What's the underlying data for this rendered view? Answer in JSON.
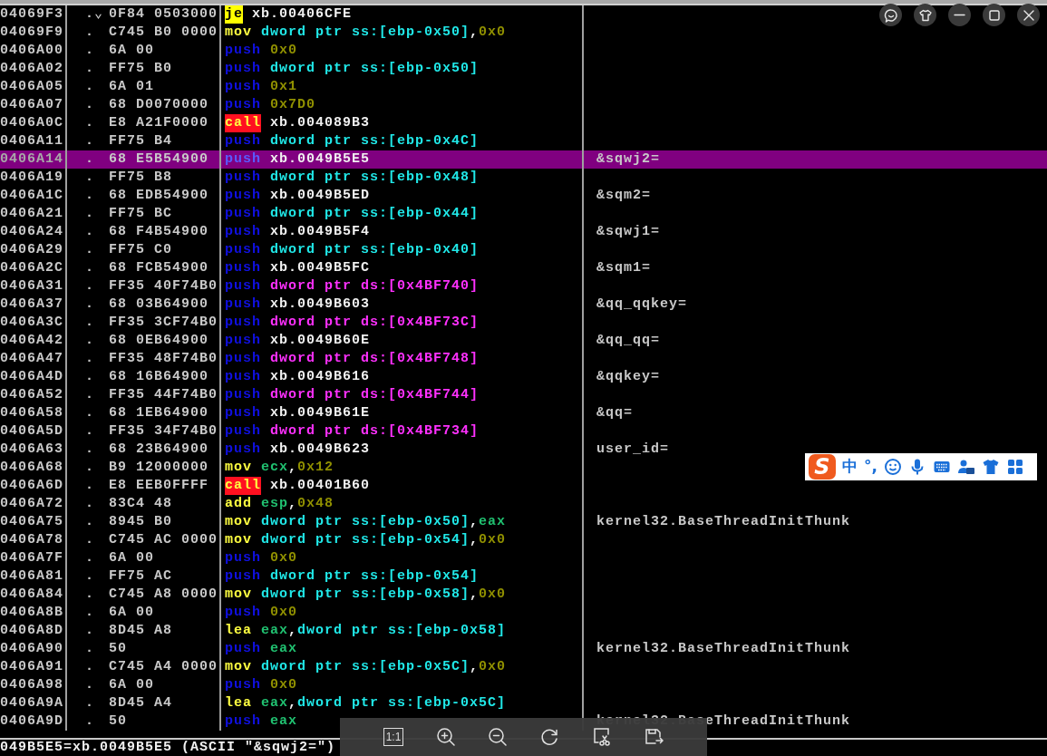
{
  "rows": [
    {
      "address": "04069F3",
      "marker": ".⌄",
      "hex": "0F84 0503000",
      "mnemonic": {
        "text": "je",
        "kind": "jump"
      },
      "operands": [
        {
          "text": "xb.00406CFE",
          "kind": "label"
        }
      ],
      "selected": false
    },
    {
      "address": "04069F9",
      "marker": ".",
      "hex": "C745 B0 0000",
      "mnemonic": {
        "text": "mov",
        "kind": "alu"
      },
      "operands": [
        {
          "text": "dword ptr ss:[ebp-0x50]",
          "kind": "stack"
        },
        {
          "text": ",",
          "kind": "sep"
        },
        {
          "text": "0x0",
          "kind": "const"
        }
      ],
      "selected": false
    },
    {
      "address": "0406A00",
      "marker": ".",
      "hex": "6A 00",
      "mnemonic": {
        "text": "push",
        "kind": "push"
      },
      "operands": [
        {
          "text": "0x0",
          "kind": "const"
        }
      ],
      "selected": false
    },
    {
      "address": "0406A02",
      "marker": ".",
      "hex": "FF75 B0",
      "mnemonic": {
        "text": "push",
        "kind": "push"
      },
      "operands": [
        {
          "text": "dword ptr ss:[ebp-0x50]",
          "kind": "stack"
        }
      ],
      "selected": false
    },
    {
      "address": "0406A05",
      "marker": ".",
      "hex": "6A 01",
      "mnemonic": {
        "text": "push",
        "kind": "push"
      },
      "operands": [
        {
          "text": "0x1",
          "kind": "const"
        }
      ],
      "selected": false
    },
    {
      "address": "0406A07",
      "marker": ".",
      "hex": "68 D0070000",
      "mnemonic": {
        "text": "push",
        "kind": "push"
      },
      "operands": [
        {
          "text": "0x7D0",
          "kind": "const"
        }
      ],
      "selected": false
    },
    {
      "address": "0406A0C",
      "marker": ".",
      "hex": "E8 A21F0000",
      "mnemonic": {
        "text": "call",
        "kind": "call"
      },
      "operands": [
        {
          "text": "xb.004089B3",
          "kind": "label"
        }
      ],
      "selected": false
    },
    {
      "address": "0406A11",
      "marker": ".",
      "hex": "FF75 B4",
      "mnemonic": {
        "text": "push",
        "kind": "push"
      },
      "operands": [
        {
          "text": "dword ptr ss:[ebp-0x4C]",
          "kind": "stack"
        }
      ],
      "selected": false
    },
    {
      "address": "0406A14",
      "marker": ".",
      "hex": "68 E5B54900",
      "mnemonic": {
        "text": "push",
        "kind": "push"
      },
      "operands": [
        {
          "text": "xb.0049B5E5",
          "kind": "label"
        }
      ],
      "comment": "&sqwj2=",
      "selected": true
    },
    {
      "address": "0406A19",
      "marker": ".",
      "hex": "FF75 B8",
      "mnemonic": {
        "text": "push",
        "kind": "push"
      },
      "operands": [
        {
          "text": "dword ptr ss:[ebp-0x48]",
          "kind": "stack"
        }
      ],
      "selected": false
    },
    {
      "address": "0406A1C",
      "marker": ".",
      "hex": "68 EDB54900",
      "mnemonic": {
        "text": "push",
        "kind": "push"
      },
      "operands": [
        {
          "text": "xb.0049B5ED",
          "kind": "label"
        }
      ],
      "comment": "&sqm2=",
      "selected": false
    },
    {
      "address": "0406A21",
      "marker": ".",
      "hex": "FF75 BC",
      "mnemonic": {
        "text": "push",
        "kind": "push"
      },
      "operands": [
        {
          "text": "dword ptr ss:[ebp-0x44]",
          "kind": "stack"
        }
      ],
      "selected": false
    },
    {
      "address": "0406A24",
      "marker": ".",
      "hex": "68 F4B54900",
      "mnemonic": {
        "text": "push",
        "kind": "push"
      },
      "operands": [
        {
          "text": "xb.0049B5F4",
          "kind": "label"
        }
      ],
      "comment": "&sqwj1=",
      "selected": false
    },
    {
      "address": "0406A29",
      "marker": ".",
      "hex": "FF75 C0",
      "mnemonic": {
        "text": "push",
        "kind": "push"
      },
      "operands": [
        {
          "text": "dword ptr ss:[ebp-0x40]",
          "kind": "stack"
        }
      ],
      "selected": false
    },
    {
      "address": "0406A2C",
      "marker": ".",
      "hex": "68 FCB54900",
      "mnemonic": {
        "text": "push",
        "kind": "push"
      },
      "operands": [
        {
          "text": "xb.0049B5FC",
          "kind": "label"
        }
      ],
      "comment": "&sqm1=",
      "selected": false
    },
    {
      "address": "0406A31",
      "marker": ".",
      "hex": "FF35 40F74B0",
      "mnemonic": {
        "text": "push",
        "kind": "push"
      },
      "operands": [
        {
          "text": "dword ptr ds:[0x4BF740]",
          "kind": "global"
        }
      ],
      "selected": false
    },
    {
      "address": "0406A37",
      "marker": ".",
      "hex": "68 03B64900",
      "mnemonic": {
        "text": "push",
        "kind": "push"
      },
      "operands": [
        {
          "text": "xb.0049B603",
          "kind": "label"
        }
      ],
      "comment": "&qq_qqkey=",
      "selected": false
    },
    {
      "address": "0406A3C",
      "marker": ".",
      "hex": "FF35 3CF74B0",
      "mnemonic": {
        "text": "push",
        "kind": "push"
      },
      "operands": [
        {
          "text": "dword ptr ds:[0x4BF73C]",
          "kind": "global"
        }
      ],
      "selected": false
    },
    {
      "address": "0406A42",
      "marker": ".",
      "hex": "68 0EB64900",
      "mnemonic": {
        "text": "push",
        "kind": "push"
      },
      "operands": [
        {
          "text": "xb.0049B60E",
          "kind": "label"
        }
      ],
      "comment": "&qq_qq=",
      "selected": false
    },
    {
      "address": "0406A47",
      "marker": ".",
      "hex": "FF35 48F74B0",
      "mnemonic": {
        "text": "push",
        "kind": "push"
      },
      "operands": [
        {
          "text": "dword ptr ds:[0x4BF748]",
          "kind": "global"
        }
      ],
      "selected": false
    },
    {
      "address": "0406A4D",
      "marker": ".",
      "hex": "68 16B64900",
      "mnemonic": {
        "text": "push",
        "kind": "push"
      },
      "operands": [
        {
          "text": "xb.0049B616",
          "kind": "label"
        }
      ],
      "comment": "&qqkey=",
      "selected": false
    },
    {
      "address": "0406A52",
      "marker": ".",
      "hex": "FF35 44F74B0",
      "mnemonic": {
        "text": "push",
        "kind": "push"
      },
      "operands": [
        {
          "text": "dword ptr ds:[0x4BF744]",
          "kind": "global"
        }
      ],
      "selected": false
    },
    {
      "address": "0406A58",
      "marker": ".",
      "hex": "68 1EB64900",
      "mnemonic": {
        "text": "push",
        "kind": "push"
      },
      "operands": [
        {
          "text": "xb.0049B61E",
          "kind": "label"
        }
      ],
      "comment": "&qq=",
      "selected": false
    },
    {
      "address": "0406A5D",
      "marker": ".",
      "hex": "FF35 34F74B0",
      "mnemonic": {
        "text": "push",
        "kind": "push"
      },
      "operands": [
        {
          "text": "dword ptr ds:[0x4BF734]",
          "kind": "global"
        }
      ],
      "selected": false
    },
    {
      "address": "0406A63",
      "marker": ".",
      "hex": "68 23B64900",
      "mnemonic": {
        "text": "push",
        "kind": "push"
      },
      "operands": [
        {
          "text": "xb.0049B623",
          "kind": "label"
        }
      ],
      "comment": "user_id=",
      "selected": false
    },
    {
      "address": "0406A68",
      "marker": ".",
      "hex": "B9 12000000",
      "mnemonic": {
        "text": "mov",
        "kind": "alu"
      },
      "operands": [
        {
          "text": "ecx",
          "kind": "reg"
        },
        {
          "text": ",",
          "kind": "sep"
        },
        {
          "text": "0x12",
          "kind": "const"
        }
      ],
      "selected": false
    },
    {
      "address": "0406A6D",
      "marker": ".",
      "hex": "E8 EEB0FFFF",
      "mnemonic": {
        "text": "call",
        "kind": "call"
      },
      "operands": [
        {
          "text": "xb.00401B60",
          "kind": "label"
        }
      ],
      "selected": false
    },
    {
      "address": "0406A72",
      "marker": ".",
      "hex": "83C4 48",
      "mnemonic": {
        "text": "add",
        "kind": "alu"
      },
      "operands": [
        {
          "text": "esp",
          "kind": "reg"
        },
        {
          "text": ",",
          "kind": "sep"
        },
        {
          "text": "0x48",
          "kind": "const"
        }
      ],
      "selected": false
    },
    {
      "address": "0406A75",
      "marker": ".",
      "hex": "8945 B0",
      "mnemonic": {
        "text": "mov",
        "kind": "alu"
      },
      "operands": [
        {
          "text": "dword ptr ss:[ebp-0x50]",
          "kind": "stack"
        },
        {
          "text": ",",
          "kind": "sep"
        },
        {
          "text": "eax",
          "kind": "reg"
        }
      ],
      "comment": "kernel32.BaseThreadInitThunk",
      "selected": false
    },
    {
      "address": "0406A78",
      "marker": ".",
      "hex": "C745 AC 0000",
      "mnemonic": {
        "text": "mov",
        "kind": "alu"
      },
      "operands": [
        {
          "text": "dword ptr ss:[ebp-0x54]",
          "kind": "stack"
        },
        {
          "text": ",",
          "kind": "sep"
        },
        {
          "text": "0x0",
          "kind": "const"
        }
      ],
      "selected": false
    },
    {
      "address": "0406A7F",
      "marker": ".",
      "hex": "6A 00",
      "mnemonic": {
        "text": "push",
        "kind": "push"
      },
      "operands": [
        {
          "text": "0x0",
          "kind": "const"
        }
      ],
      "selected": false
    },
    {
      "address": "0406A81",
      "marker": ".",
      "hex": "FF75 AC",
      "mnemonic": {
        "text": "push",
        "kind": "push"
      },
      "operands": [
        {
          "text": "dword ptr ss:[ebp-0x54]",
          "kind": "stack"
        }
      ],
      "selected": false
    },
    {
      "address": "0406A84",
      "marker": ".",
      "hex": "C745 A8 0000",
      "mnemonic": {
        "text": "mov",
        "kind": "alu"
      },
      "operands": [
        {
          "text": "dword ptr ss:[ebp-0x58]",
          "kind": "stack"
        },
        {
          "text": ",",
          "kind": "sep"
        },
        {
          "text": "0x0",
          "kind": "const"
        }
      ],
      "selected": false
    },
    {
      "address": "0406A8B",
      "marker": ".",
      "hex": "6A 00",
      "mnemonic": {
        "text": "push",
        "kind": "push"
      },
      "operands": [
        {
          "text": "0x0",
          "kind": "const"
        }
      ],
      "selected": false
    },
    {
      "address": "0406A8D",
      "marker": ".",
      "hex": "8D45 A8",
      "mnemonic": {
        "text": "lea",
        "kind": "alu"
      },
      "operands": [
        {
          "text": "eax",
          "kind": "reg"
        },
        {
          "text": ",",
          "kind": "sep"
        },
        {
          "text": "dword ptr ss:[ebp-0x58]",
          "kind": "stack"
        }
      ],
      "selected": false
    },
    {
      "address": "0406A90",
      "marker": ".",
      "hex": "50",
      "mnemonic": {
        "text": "push",
        "kind": "push"
      },
      "operands": [
        {
          "text": "eax",
          "kind": "reg"
        }
      ],
      "comment": "kernel32.BaseThreadInitThunk",
      "selected": false
    },
    {
      "address": "0406A91",
      "marker": ".",
      "hex": "C745 A4 0000",
      "mnemonic": {
        "text": "mov",
        "kind": "alu"
      },
      "operands": [
        {
          "text": "dword ptr ss:[ebp-0x5C]",
          "kind": "stack"
        },
        {
          "text": ",",
          "kind": "sep"
        },
        {
          "text": "0x0",
          "kind": "const"
        }
      ],
      "selected": false
    },
    {
      "address": "0406A98",
      "marker": ".",
      "hex": "6A 00",
      "mnemonic": {
        "text": "push",
        "kind": "push"
      },
      "operands": [
        {
          "text": "0x0",
          "kind": "const"
        }
      ],
      "selected": false
    },
    {
      "address": "0406A9A",
      "marker": ".",
      "hex": "8D45 A4",
      "mnemonic": {
        "text": "lea",
        "kind": "alu"
      },
      "operands": [
        {
          "text": "eax",
          "kind": "reg"
        },
        {
          "text": ",",
          "kind": "sep"
        },
        {
          "text": "dword ptr ss:[ebp-0x5C]",
          "kind": "stack"
        }
      ],
      "selected": false
    },
    {
      "address": "0406A9D",
      "marker": ".",
      "hex": "50",
      "mnemonic": {
        "text": "push",
        "kind": "push"
      },
      "operands": [
        {
          "text": "eax",
          "kind": "reg"
        }
      ],
      "comment": "kernel32.BaseThreadInitThunk",
      "selected": false
    }
  ],
  "status_bar": "049B5E5=xb.0049B5E5 (ASCII \"&sqwj2=\")",
  "ime_toolbar": {
    "logo": "S",
    "mode": "中",
    "punctuation": "°,"
  },
  "viewer_toolbar": {
    "actual_size": "1:1"
  }
}
